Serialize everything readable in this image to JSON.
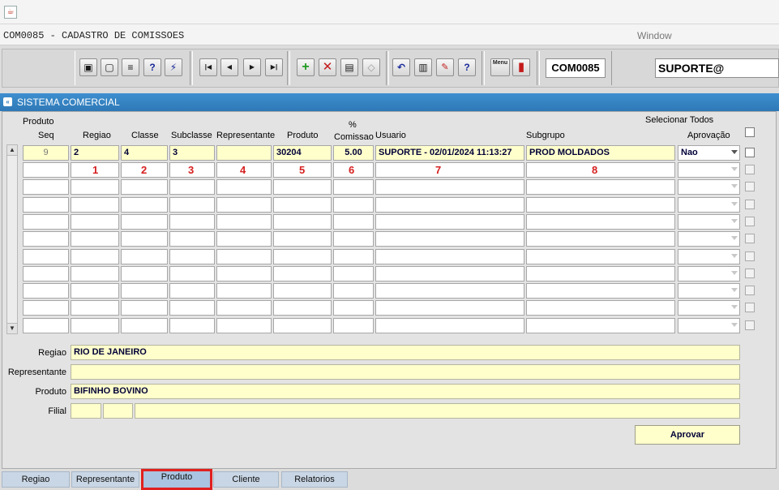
{
  "window": {
    "title": "COM0085 - CADASTRO DE COMISSOES",
    "menu_label": "Window"
  },
  "toolbar": {
    "form_code": "COM0085",
    "user": "SUPORTE@",
    "menu_icon_label": "Menu"
  },
  "panel": {
    "title": "SISTEMA COMERCIAL"
  },
  "grid": {
    "headers": {
      "produto_top": "Produto",
      "seq": "Seq",
      "regiao": "Regiao",
      "classe": "Classe",
      "subclasse": "Subclasse",
      "representante": "Representante",
      "produto": "Produto",
      "pct": "%",
      "comissao": "Comissao",
      "usuario": "Usuario",
      "subgrupo": "Subgrupo",
      "selecionar_todos": "Selecionar Todos",
      "aprovacao": "Aprovação"
    },
    "row1": {
      "seq": "9",
      "regiao": "2",
      "classe": "4",
      "subclasse": "3",
      "representante": "",
      "produto": "30204",
      "comissao": "5.00",
      "usuario": "SUPORTE - 02/01/2024 11:13:27",
      "subgrupo": "PROD MOLDADOS",
      "aprovacao": "Nao"
    },
    "annotations": [
      "1",
      "2",
      "3",
      "4",
      "5",
      "6",
      "7",
      "8"
    ]
  },
  "details": {
    "regiao_label": "Regiao",
    "regiao_value": "RIO DE JANEIRO",
    "representante_label": "Representante",
    "representante_value": "",
    "produto_label": "Produto",
    "produto_value": "BIFINHO BOVINO",
    "filial_label": "Filial"
  },
  "actions": {
    "aprovar": "Aprovar"
  },
  "tabs": [
    {
      "label": "Regiao"
    },
    {
      "label": "Representante"
    },
    {
      "label": "Produto"
    },
    {
      "label": "Cliente"
    },
    {
      "label": "Relatorios"
    }
  ]
}
